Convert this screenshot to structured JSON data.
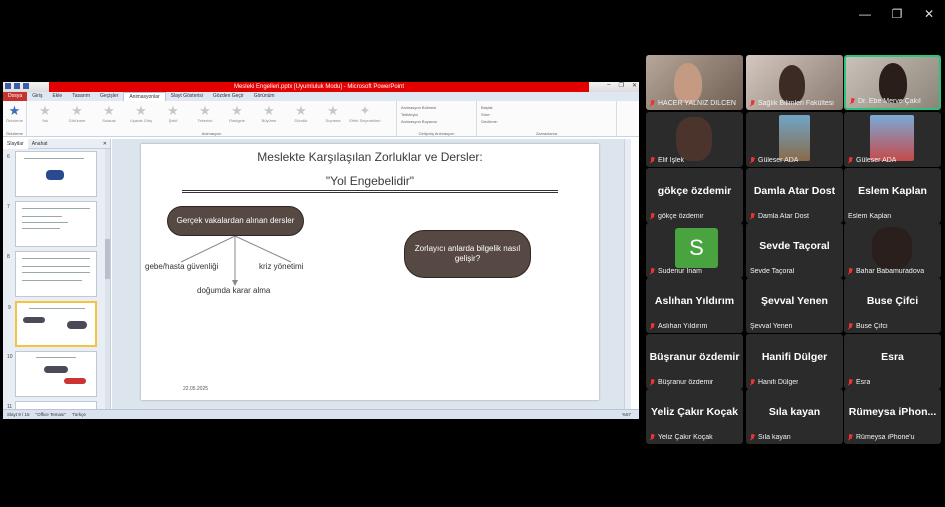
{
  "window": {
    "minimize": "—",
    "restore": "❐",
    "close": "✕"
  },
  "powerpoint": {
    "title_bar": "Mesleki Engelleri.pptx [Uyumluluk Modu] - Microsoft PowerPoint",
    "tabs": [
      "Dosya",
      "Giriş",
      "Ekle",
      "Tasarım",
      "Geçişler",
      "Animasyonlar",
      "Slayt Gösterisi",
      "Gözden Geçir",
      "Görünüm"
    ],
    "active_tab": "Animasyonlar",
    "ribbon": {
      "preview_label": "Önizleme",
      "animations": [
        "Yok",
        "Görünme",
        "Solarak",
        "Uçarak Giriş",
        "Şekil",
        "Tekerlek",
        "Rastgele",
        "Büyüme",
        "Döndür",
        "Sıçrama"
      ],
      "effect_options": "Efekt Seçenekleri",
      "add_animation": "Animasyon Ekle",
      "animation_pane": "Animasyon Bölmesi",
      "trigger": "Tetikleyici",
      "animation_painter": "Animasyon Boyacısı",
      "start": "Başlat:",
      "duration": "Süre:",
      "delay": "Gecikme:",
      "reorder": "Animasyonu Yeniden Sırala",
      "move_earlier": "Daha Önceye Taşı",
      "move_later": "Daha Sonraya Taşı",
      "groups": [
        "Önizleme",
        "Animasyon",
        "Gelişmiş Animasyon",
        "Zamanlama"
      ]
    },
    "pane_tabs": [
      "Slaytlar",
      "Anahat"
    ],
    "thumb_numbers": [
      "6",
      "7",
      "8",
      "9",
      "10",
      "11"
    ],
    "slide": {
      "title": "Meslekte Karşılaşılan Zorluklar ve Dersler:",
      "subtitle": "\"Yol Engebelidir\"",
      "bubble1": "Gerçek vakalardan alınan dersler",
      "bubble2": "Zorlayıcı anlarda bilgelik nasıl gelişir?",
      "branch_left": "gebe/hasta güvenliği",
      "branch_right": "kriz yönetimi",
      "branch_bottom": "doğumda karar alma",
      "date": "22.05.2025"
    },
    "status": {
      "slide_info": "Slayt 9 / 15",
      "theme": "\"Office Teması\"",
      "language": "Türkçe",
      "zoom": "%57"
    }
  },
  "participants": [
    {
      "name": "HACER YALNIZ DİLCEN",
      "video": true
    },
    {
      "name": "Sağlık Bilimleri Fakültesi",
      "video": true
    },
    {
      "name": "Dr. Ebe Merve Çakıl",
      "video": true,
      "speaking": true
    },
    {
      "name": "Elif İşlek",
      "video": true
    },
    {
      "name": "Güleser ADA",
      "video": true
    },
    {
      "name": "Güleser ADA",
      "video": true
    },
    {
      "name": "gökçe özdemir",
      "display": "gökçe özdemir"
    },
    {
      "name": "Damla Atar Dost",
      "display": "Damla Atar Dost"
    },
    {
      "name": "Eslem Kaplan",
      "display": "Eslem Kaplan"
    },
    {
      "name": "Sudenur İnam",
      "avatar_letter": "S"
    },
    {
      "name": "Sevde Taçoral",
      "display": "Sevde Taçoral"
    },
    {
      "name": "Bahar Babamuradova",
      "video": true
    },
    {
      "name": "Aslıhan Yıldırım",
      "display": "Aslıhan Yıldırım"
    },
    {
      "name": "Şevval Yenen",
      "display": "Şevval Yenen"
    },
    {
      "name": "Buse Çifci",
      "display": "Buse Çifci"
    },
    {
      "name": "Büşranur özdemir",
      "display": "Büşranur özdemir"
    },
    {
      "name": "Hanifi Dülger",
      "display": "Hanifi Dülger"
    },
    {
      "name": "Esra",
      "display": "Esra"
    },
    {
      "name": "Yeliz Çakır Koçak",
      "display": "Yeliz Çakır Koçak"
    },
    {
      "name": "Sıla kayan",
      "display": "Sıla kayan"
    },
    {
      "name": "Rümeysa iPhone'u",
      "display": "Rümeysa iPhon..."
    }
  ],
  "colors": {
    "speaking_border": "#2ec27e",
    "muted_mic": "#e33333",
    "bubble": "#564842",
    "file_tab": "#c4342d"
  }
}
